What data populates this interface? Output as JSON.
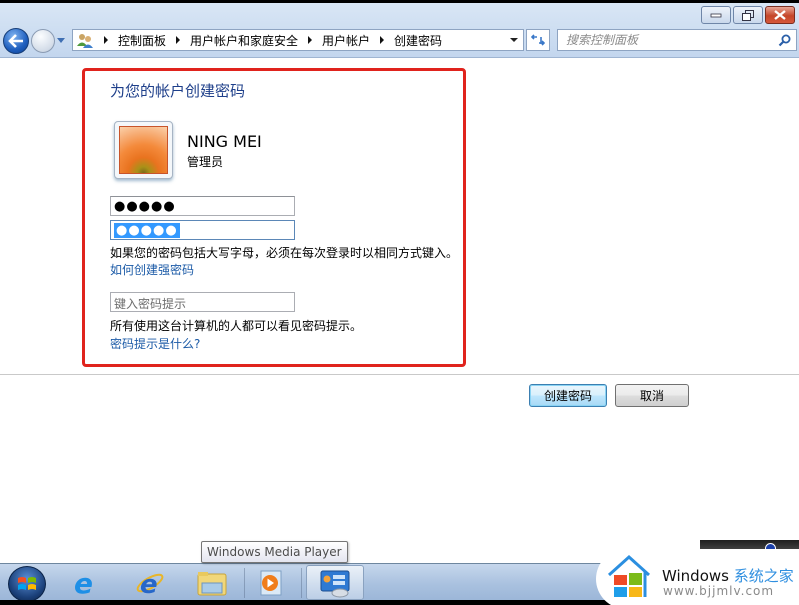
{
  "window": {
    "minimize_label": "Minimize",
    "restore_label": "Restore",
    "close_label": "Close"
  },
  "navigation": {
    "back_icon": "back-arrow-icon",
    "forward_icon": "forward-arrow-icon",
    "breadcrumbs": [
      "控制面板",
      "用户帐户和家庭安全",
      "用户帐户",
      "创建密码"
    ],
    "search_placeholder": "搜索控制面板"
  },
  "main": {
    "title": "为您的帐户创建密码",
    "user": {
      "name": "NING MEI",
      "role": "管理员"
    },
    "new_password_value": "●●●●●",
    "confirm_password_value": "●●●●●",
    "caps_note": "如果您的密码包括大写字母，必须在每次登录时以相同方式键入。",
    "strong_password_link": "如何创建强密码",
    "hint_placeholder": "键入密码提示",
    "hint_value": "",
    "hint_note": "所有使用这台计算机的人都可以看见密码提示。",
    "hint_help_link": "密码提示是什么?"
  },
  "buttons": {
    "create_label": "创建密码",
    "cancel_label": "取消"
  },
  "taskbar": {
    "tooltip": "Windows Media Player",
    "items": [
      "Start",
      "Internet Explorer",
      "Internet Explorer",
      "Windows Explorer",
      "Windows Media Player",
      "Control Panel"
    ]
  },
  "watermark": {
    "brand": "Windows",
    "brand_cn": "系统之家",
    "url": "www.bjjmlv.com"
  },
  "colors": {
    "highlight_border": "#e0231d",
    "title_blue": "#1e3f8a",
    "link_blue": "#1c5ba7",
    "selection_blue": "#3399ff"
  }
}
